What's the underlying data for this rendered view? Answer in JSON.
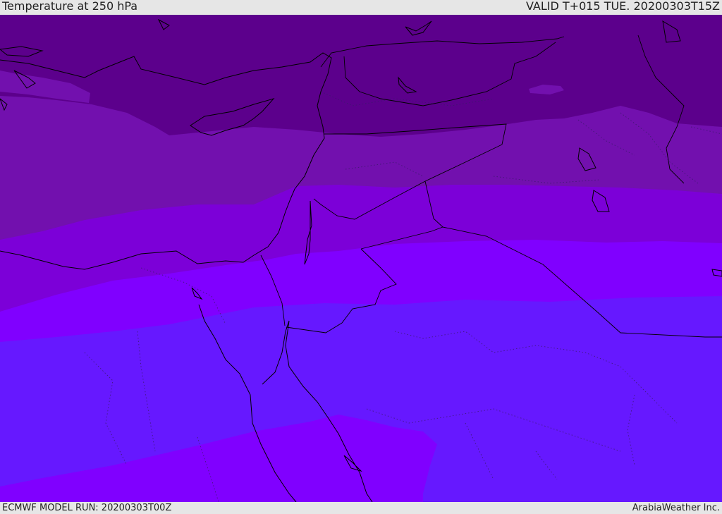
{
  "header": {
    "title": "Temperature at 250 hPa",
    "valid": "VALID T+015 TUE. 20200303T15Z"
  },
  "footer": {
    "model_run": "ECMWF MODEL RUN: 20200303T00Z",
    "credit": "ArabiaWeather Inc."
  },
  "map": {
    "variable": "Temperature",
    "level": "250 hPa",
    "colors": {
      "band_1": "#5c008c",
      "band_2": "#7210ae",
      "band_3": "#7c00d8",
      "band_4": "#8000ff",
      "band_5": "#6618ff",
      "coastline": "#000000"
    }
  }
}
